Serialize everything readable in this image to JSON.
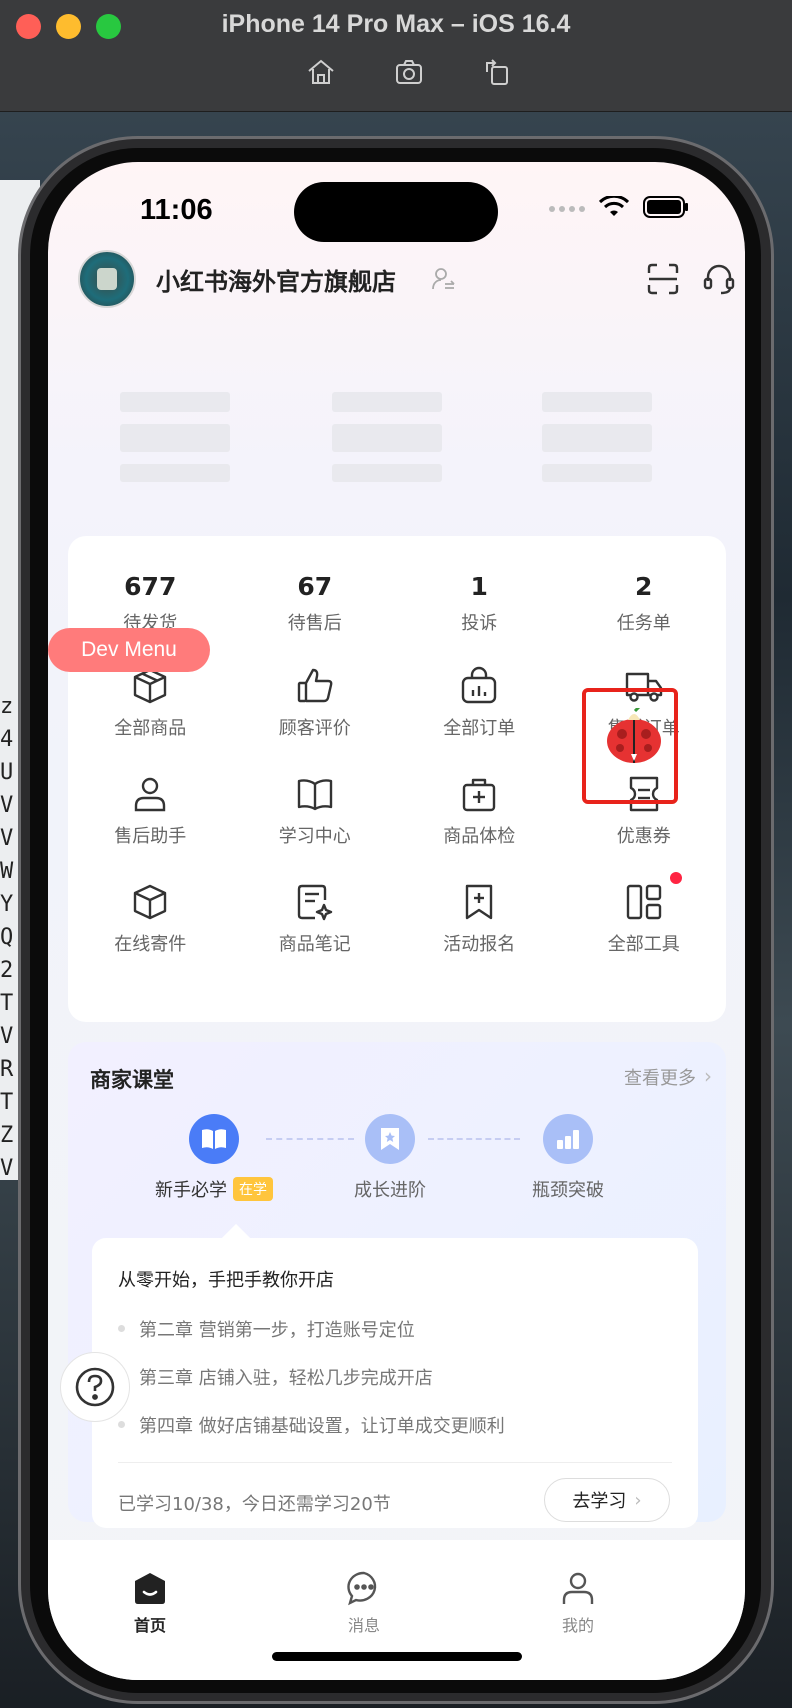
{
  "simulator": {
    "title": "iPhone 14 Pro Max – iOS 16.4",
    "tools": [
      "home-icon",
      "screenshot-icon",
      "rotate-icon"
    ]
  },
  "desktop": {
    "side_letters": [
      "z",
      "4",
      "U",
      "V",
      "V",
      "W",
      "Y",
      "Q",
      "2",
      "T",
      "V",
      "R",
      "T",
      "Z",
      "V"
    ]
  },
  "status_bar": {
    "time": "11:06"
  },
  "header": {
    "shop_name": "小红书海外官方旗舰店"
  },
  "stats": [
    {
      "value": "677",
      "label": "待发货"
    },
    {
      "value": "67",
      "label": "待售后"
    },
    {
      "value": "1",
      "label": "投诉"
    },
    {
      "value": "2",
      "label": "任务单"
    }
  ],
  "tools": [
    {
      "label": "全部商品",
      "icon": "box-icon"
    },
    {
      "label": "顾客评价",
      "icon": "thumbs-up-icon"
    },
    {
      "label": "全部订单",
      "icon": "order-bag-icon"
    },
    {
      "label": "售后订单",
      "icon": "truck-icon"
    },
    {
      "label": "售后助手",
      "icon": "person-icon"
    },
    {
      "label": "学习中心",
      "icon": "book-icon"
    },
    {
      "label": "商品体检",
      "icon": "medical-bag-icon"
    },
    {
      "label": "优惠券",
      "icon": "coupon-icon"
    },
    {
      "label": "在线寄件",
      "icon": "parcel-icon"
    },
    {
      "label": "商品笔记",
      "icon": "note-icon"
    },
    {
      "label": "活动报名",
      "icon": "bookmark-plus-icon"
    },
    {
      "label": "全部工具",
      "icon": "grid-icon"
    }
  ],
  "dev_menu": {
    "label": "Dev Menu"
  },
  "course": {
    "title": "商家课堂",
    "more": "查看更多",
    "steps": [
      {
        "label": "新手必学",
        "badge": "在学"
      },
      {
        "label": "成长进阶"
      },
      {
        "label": "瓶颈突破"
      }
    ],
    "headline": "从零开始，手把手教你开店",
    "lessons": [
      "第二章 营销第一步，打造账号定位",
      "第三章 店铺入驻，轻松几步完成开店",
      "第四章 做好店铺基础设置，让订单成交更顺利"
    ],
    "progress_text": "已学习10/38，今日还需学习20节",
    "study_button": "去学习"
  },
  "tabbar": [
    {
      "label": "首页",
      "active": true
    },
    {
      "label": "消息",
      "active": false
    },
    {
      "label": "我的",
      "active": false
    }
  ],
  "colors": {
    "accent_red": "#ff2442",
    "highlight_box": "#e8231b",
    "dev_menu": "#ff7b7b",
    "step_active": "#4a7cf7",
    "step_inactive": "#a9bff7"
  }
}
